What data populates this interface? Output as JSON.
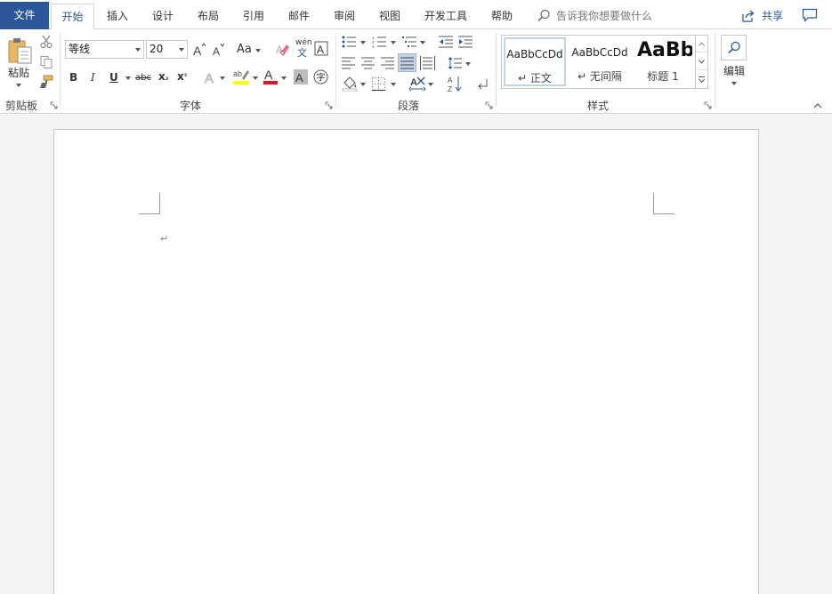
{
  "tabs": {
    "file": "文件",
    "home": "开始",
    "insert": "插入",
    "design": "设计",
    "layout": "布局",
    "references": "引用",
    "mailings": "邮件",
    "review": "审阅",
    "view": "视图",
    "developer": "开发工具",
    "help": "帮助"
  },
  "tell_me": {
    "placeholder": "告诉我你想要做什么",
    "icon": "search-icon"
  },
  "share": {
    "label": "共享",
    "icon": "share-icon"
  },
  "comments": {
    "icon": "comment-icon"
  },
  "clipboard": {
    "paste_label": "粘贴",
    "group_label": "剪贴板",
    "icons": [
      "cut-icon",
      "copy-icon",
      "format-painter-icon"
    ]
  },
  "font": {
    "group_label": "字体",
    "font_name": "等线",
    "font_size": "20",
    "change_case_label": "Aa",
    "phonetic_top": "wén",
    "phonetic_bottom": "文",
    "bold": "B",
    "italic": "I",
    "underline": "U",
    "strikethrough": "abc",
    "subscript": "x",
    "superscript": "x",
    "highlight_color": "#ffff00",
    "font_color": "#e81123"
  },
  "paragraph": {
    "group_label": "段落"
  },
  "styles": {
    "group_label": "样式",
    "items": [
      {
        "preview": "AaBbCcDd",
        "name": "↵ 正文"
      },
      {
        "preview": "AaBbCcDd",
        "name": "↵ 无间隔"
      },
      {
        "preview": "AaBb",
        "name": "标题 1"
      }
    ]
  },
  "editing": {
    "label": "编辑",
    "icon": "find-icon"
  },
  "document": {
    "paragraph_mark": "↵"
  },
  "colors": {
    "accent": "#2b579a",
    "ribbon_bg": "#ffffff",
    "doc_bg": "#f3f3f3"
  }
}
